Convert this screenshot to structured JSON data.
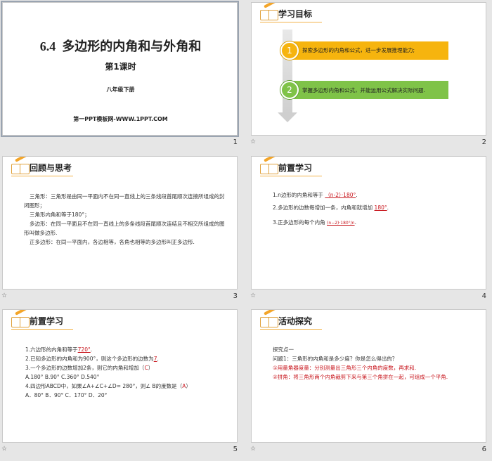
{
  "slides": [
    {
      "number": "1",
      "title_num": "6.4",
      "title": "多边形的内角和与外角和",
      "subtitle": "第1课时",
      "grade": "八年级下册",
      "footer": "第一PPT模板网-WWW.1PPT.COM"
    },
    {
      "number": "2",
      "heading": "学习目标",
      "goals": [
        {
          "index": "1",
          "text": "探索多边形的内角和公式，进一步发展推理能力;"
        },
        {
          "index": "2",
          "text": "掌握多边形内角和公式，并能运用公式解决实际问题."
        }
      ]
    },
    {
      "number": "3",
      "heading": "回顾与思考",
      "paragraphs": [
        "三角形：三角形是由同一平面内不在同一直线上的三条线段首尾顺次连接所组成的封闭图形；",
        "三角形内角和等于180°；",
        "多边形：在同一平面且不在同一直线上的多条线段首尾顺次连结且不相交所组成的图形叫做多边形.",
        "正多边形：在同一平面内，各边相等，各角也相等的多边形叫正多边形."
      ]
    },
    {
      "number": "4",
      "heading": "前置学习",
      "items": [
        {
          "prefix": "1.n边形的内角和等于",
          "answer": "（n-2）·180°",
          "suffix": "."
        },
        {
          "prefix": "2.多边形的边数每增加一条，内角和就增加",
          "answer": "180°",
          "suffix": "."
        },
        {
          "prefix": "3.正多边形的每个内角",
          "answer": "(n−2)·180°/n",
          "suffix": "."
        }
      ]
    },
    {
      "number": "5",
      "heading": "前置学习",
      "q1_prefix": "1.六边形的内角和等于",
      "q1_answer": "720°",
      "q1_suffix": ".",
      "q2_prefix": "2.已知多边形的内角和为900°，则这个多边形的边数为",
      "q2_answer": "7",
      "q2_suffix": ".",
      "q3_text": "3.一个多边形的边数增加2条，则它的内角和增加（",
      "q3_answer": "C",
      "q3_end": "）",
      "q3_options": "A.180°        B.90°        C.360°        D.540°",
      "q4_text": "4.四边形ABCD中，如果∠A+∠C+∠D= 280°，则∠ B的度数是（",
      "q4_answer": "A",
      "q4_end": "）",
      "q4_options": "A．80°    B．90°    C．170°    D．20°"
    },
    {
      "number": "6",
      "heading": "活动探究",
      "lines": [
        "探究点一",
        "问题1：三角形的内角和是多少度？你是怎么得出的？",
        "①用量角器度量：分别测量出三角形三个内角的度数，再求和.",
        "②拼角：将三角形两个内角裁剪下来与第三个角拼在一起，可组成一个平角."
      ]
    }
  ],
  "star_glyph": "☆",
  "colors": {
    "goal1": "#f6b40e",
    "goal2": "#7fc348",
    "accent": "#f2b34a",
    "red": "#c8161d"
  }
}
